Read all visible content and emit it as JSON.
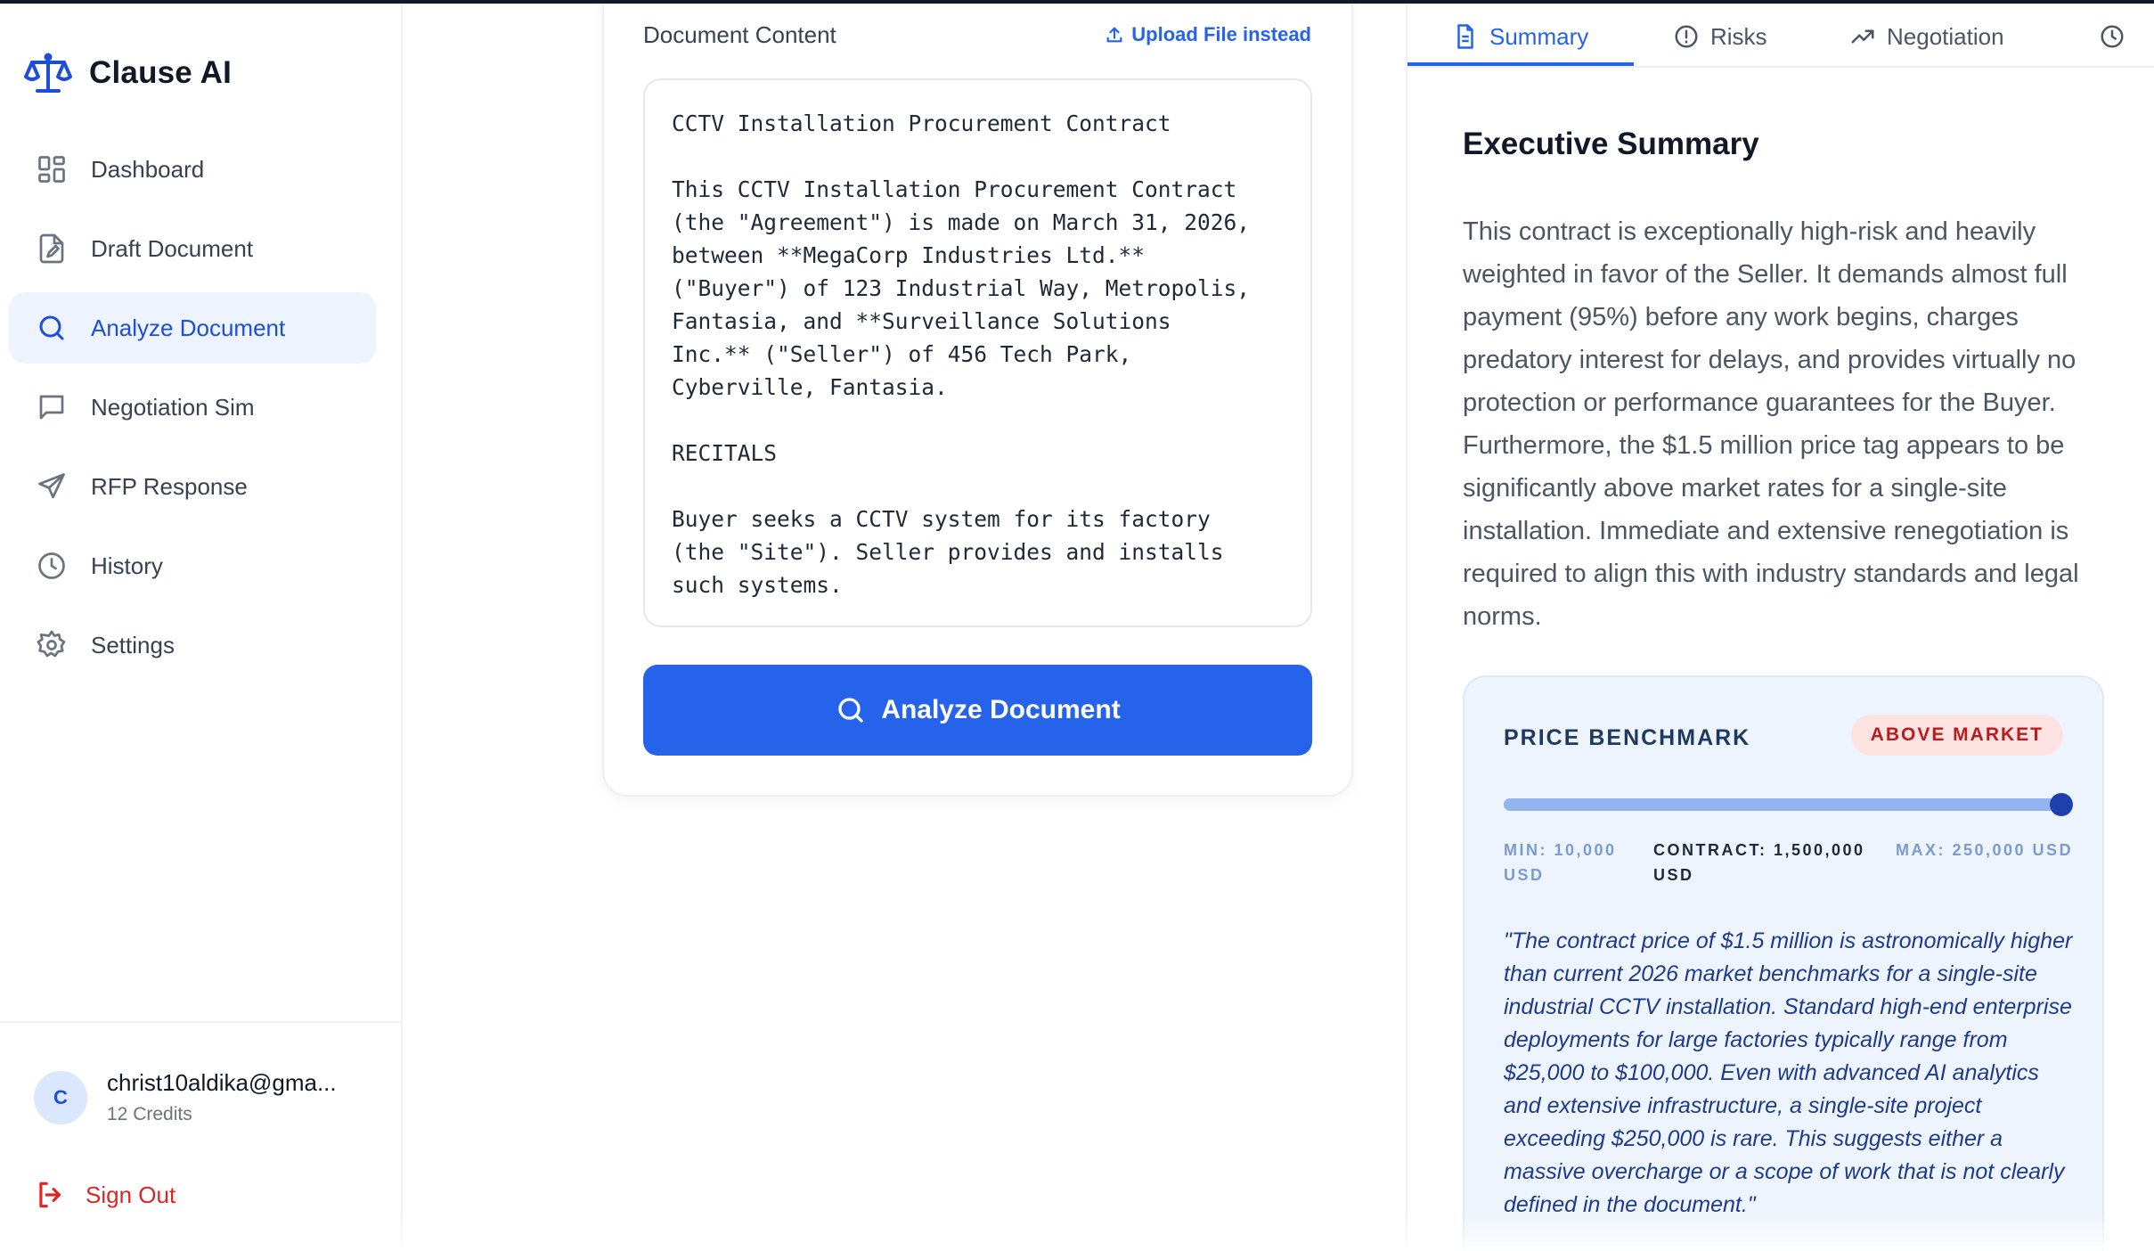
{
  "app": {
    "name": "Clause AI"
  },
  "sidebar": {
    "items": [
      {
        "label": "Dashboard",
        "icon": "dashboard-icon"
      },
      {
        "label": "Draft Document",
        "icon": "draft-document-icon"
      },
      {
        "label": "Analyze Document",
        "icon": "search-icon",
        "active": true
      },
      {
        "label": "Negotiation Sim",
        "icon": "chat-icon"
      },
      {
        "label": "RFP Response",
        "icon": "send-icon"
      },
      {
        "label": "History",
        "icon": "clock-icon"
      },
      {
        "label": "Settings",
        "icon": "gear-icon"
      }
    ],
    "user": {
      "initial": "C",
      "email": "christ10aldika@gma...",
      "credits": "12 Credits"
    },
    "sign_out": "Sign Out"
  },
  "editor": {
    "label": "Document Content",
    "upload_link": "Upload File instead",
    "content": "CCTV Installation Procurement Contract\n\nThis CCTV Installation Procurement Contract\n(the \"Agreement\") is made on March 31, 2026,\nbetween **MegaCorp Industries Ltd.**\n(\"Buyer\") of 123 Industrial Way, Metropolis,\nFantasia, and **Surveillance Solutions\nInc.** (\"Seller\") of 456 Tech Park,\nCyberville, Fantasia.\n\nRECITALS\n\nBuyer seeks a CCTV system for its factory\n(the \"Site\"). Seller provides and installs\nsuch systems.",
    "analyze_button": "Analyze Document"
  },
  "tabs": [
    {
      "label": "Summary",
      "icon": "document-icon",
      "active": true
    },
    {
      "label": "Risks",
      "icon": "alert-circle-icon"
    },
    {
      "label": "Negotiation",
      "icon": "trending-up-icon"
    },
    {
      "label": "",
      "icon": "clock-icon"
    }
  ],
  "summary": {
    "title": "Executive Summary",
    "body": "This contract is exceptionally high-risk and heavily weighted in favor of the Seller. It demands almost full payment (95%) before any work begins, charges predatory interest for delays, and provides virtually no protection or performance guarantees for the Buyer. Furthermore, the $1.5 million price tag appears to be significantly above market rates for a single-site installation. Immediate and extensive renegotiation is required to align this with industry standards and legal norms."
  },
  "benchmark": {
    "title": "PRICE BENCHMARK",
    "badge": "ABOVE MARKET",
    "position": 1.0,
    "min_label": "MIN: 10,000 USD",
    "contract_label": "CONTRACT: 1,500,000 USD",
    "max_label": "MAX: 250,000 USD",
    "quote": "\"The contract price of $1.5 million is astronomically higher than current 2026 market benchmarks for a single-site industrial CCTV installation. Standard high-end enterprise deployments for large factories typically range from $25,000 to $100,000. Even with advanced AI analytics and extensive infrastructure, a single-site project exceeding $250,000 is rare. This suggests either a massive overcharge or a scope of work that is not clearly defined in the document.\""
  },
  "colors": {
    "accent": "#2563eb",
    "danger": "#dc2626",
    "badge_bg": "#fde2e2"
  }
}
